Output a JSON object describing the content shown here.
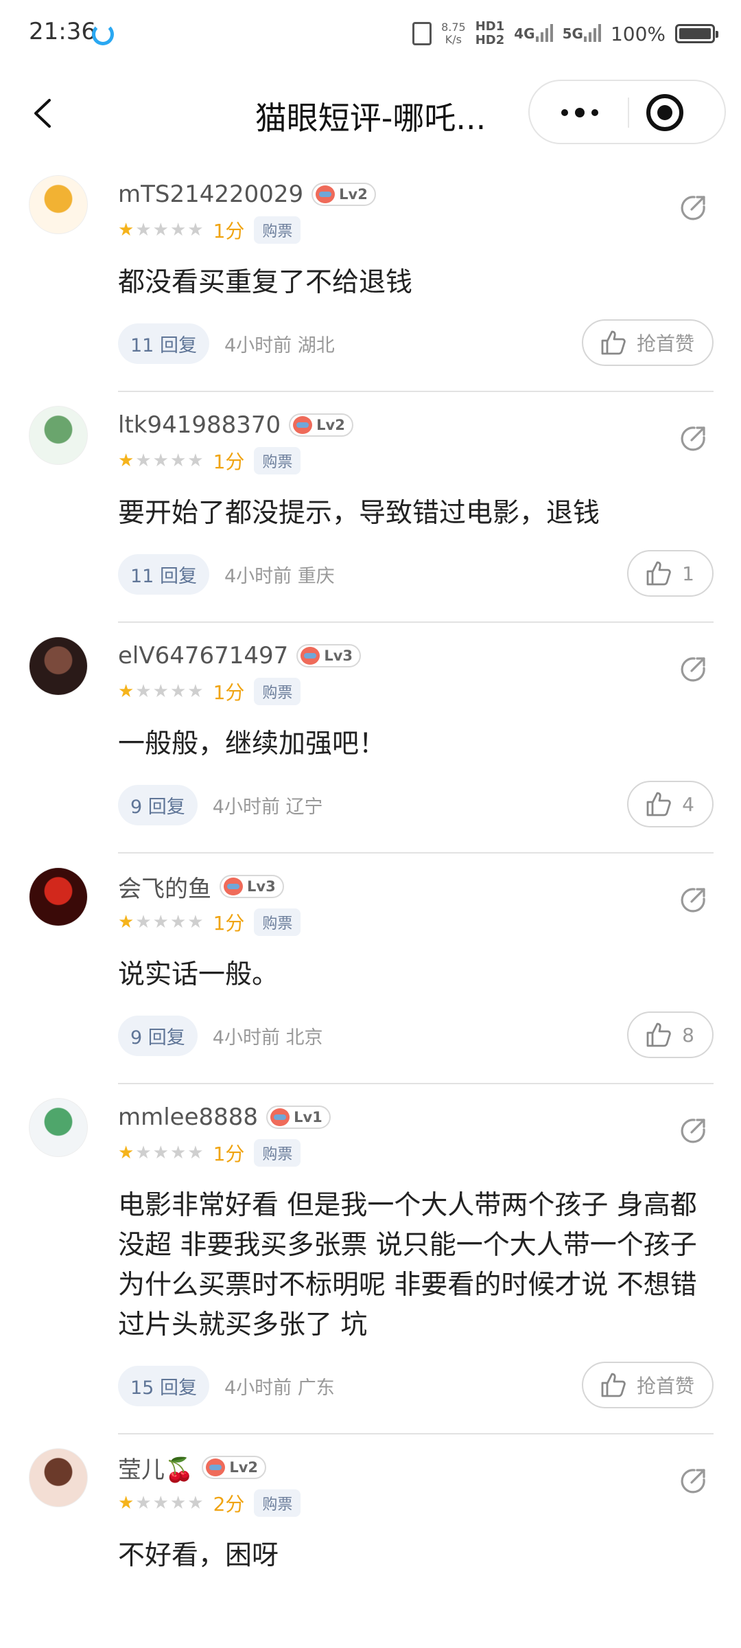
{
  "status_bar": {
    "time": "21:36",
    "speed_value": "8.75",
    "speed_unit": "K/s",
    "hd1": "HD1",
    "hd2": "HD2",
    "net1": "4G",
    "net2": "5G",
    "battery": "100%"
  },
  "nav": {
    "title": "猫眼短评-哪吒..."
  },
  "comments": [
    {
      "user": "mTS214220029",
      "level": "Lv2",
      "stars": 1,
      "score": "1分",
      "tag": "购票",
      "text": "都没看买重复了不给退钱",
      "replies": "11 回复",
      "meta": "4小时前 湖北",
      "like": "抢首赞",
      "avatar_colors": [
        "#fff6e8",
        "#f2b233"
      ]
    },
    {
      "user": "ltk941988370",
      "level": "Lv2",
      "stars": 1,
      "score": "1分",
      "tag": "购票",
      "text": "要开始了都没提示，导致错过电影，退钱",
      "replies": "11 回复",
      "meta": "4小时前 重庆",
      "like": "1",
      "avatar_colors": [
        "#eef6ef",
        "#6aa56d"
      ]
    },
    {
      "user": "elV647671497",
      "level": "Lv3",
      "stars": 1,
      "score": "1分",
      "tag": "购票",
      "text": "一般般，继续加强吧！",
      "replies": "9 回复",
      "meta": "4小时前 辽宁",
      "like": "4",
      "avatar_colors": [
        "#2a1a18",
        "#7a4a3c"
      ]
    },
    {
      "user": "会飞的鱼",
      "level": "Lv3",
      "stars": 1,
      "score": "1分",
      "tag": "购票",
      "text": "说实话一般。",
      "replies": "9 回复",
      "meta": "4小时前 北京",
      "like": "8",
      "avatar_colors": [
        "#3a0a08",
        "#d2281c"
      ]
    },
    {
      "user": "mmlee8888",
      "level": "Lv1",
      "stars": 1,
      "score": "1分",
      "tag": "购票",
      "text": "电影非常好看  但是我一个大人带两个孩子  身高都没超  非要我买多张票  说只能一个大人带一个孩子  为什么买票时不标明呢  非要看的时候才说  不想错过片头就买多张了  坑",
      "replies": "15 回复",
      "meta": "4小时前 广东",
      "like": "抢首赞",
      "avatar_colors": [
        "#f2f5f7",
        "#4fa66b"
      ]
    },
    {
      "user": "莹儿🍒",
      "level": "Lv2",
      "stars": 1,
      "score": "2分",
      "tag": "购票",
      "text": "不好看，困呀",
      "replies": "",
      "meta": "",
      "like": "",
      "avatar_colors": [
        "#f3ded4",
        "#6b3a2a"
      ]
    }
  ]
}
